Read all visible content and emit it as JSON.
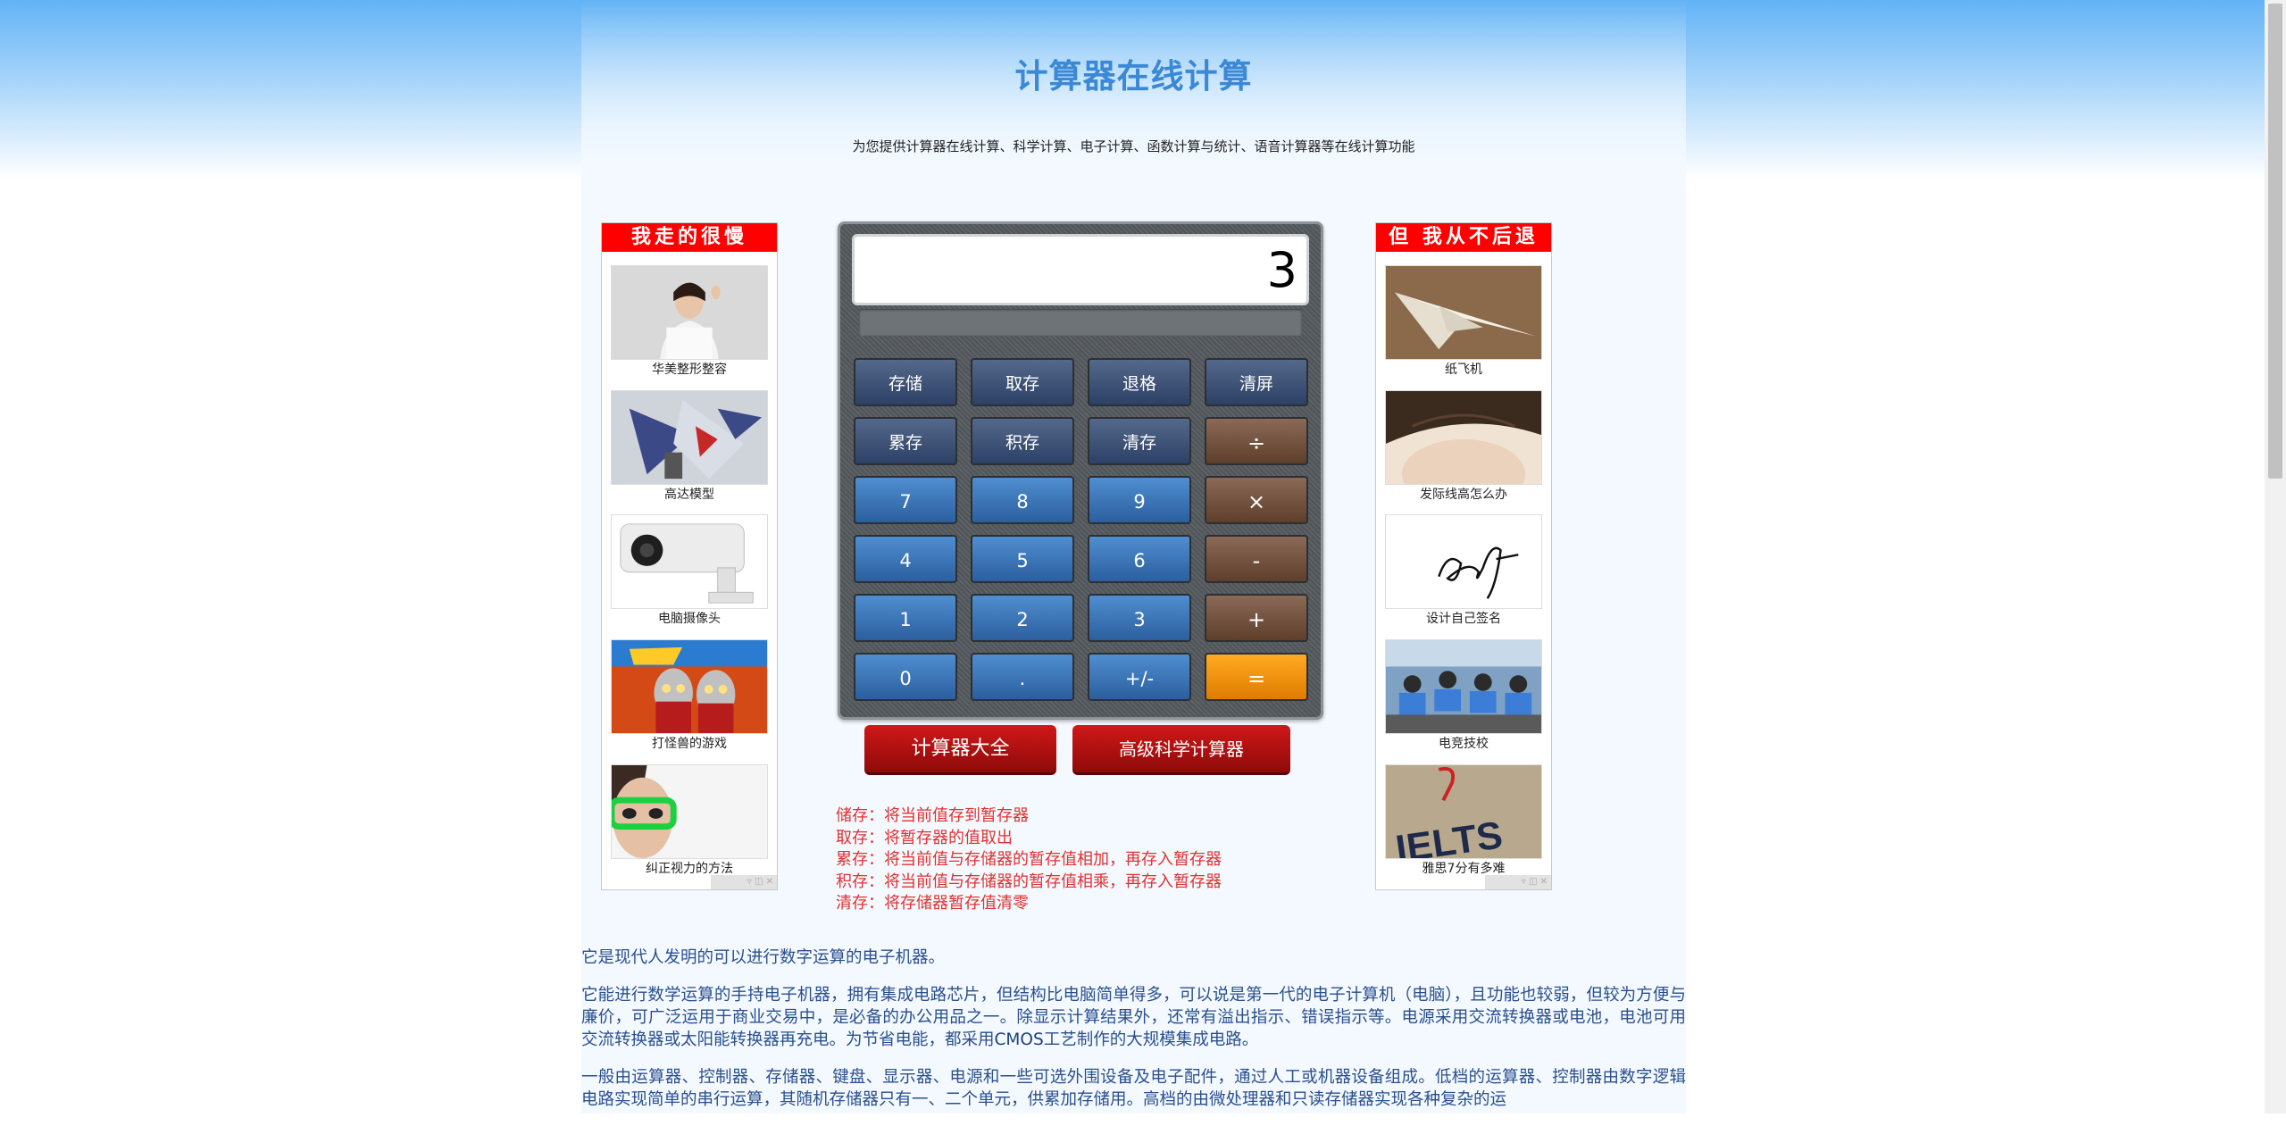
{
  "header": {
    "title": "计算器在线计算",
    "subtitle": "为您提供计算器在线计算、科学计算、电子计算、函数计算与统计、语音计算器等在线计算功能"
  },
  "left_ads": {
    "title": "我走的很慢",
    "items": [
      {
        "caption": "华美整形整容"
      },
      {
        "caption": "高达模型"
      },
      {
        "caption": "电脑摄像头"
      },
      {
        "caption": "打怪兽的游戏"
      },
      {
        "caption": "纠正视力的方法"
      }
    ]
  },
  "right_ads": {
    "title": "但 我从不后退",
    "items": [
      {
        "caption": "纸飞机"
      },
      {
        "caption": "发际线高怎么办"
      },
      {
        "caption": "设计自己签名"
      },
      {
        "caption": "电竞技校"
      },
      {
        "caption": "雅思7分有多难"
      }
    ]
  },
  "calculator": {
    "display": "3",
    "memory_keys": [
      "存储",
      "取存",
      "退格",
      "清屏",
      "累存",
      "积存",
      "清存"
    ],
    "keys": {
      "divide": "÷",
      "multiply": "×",
      "minus": "-",
      "plus": "+",
      "equals": "=",
      "n7": "7",
      "n8": "8",
      "n9": "9",
      "n4": "4",
      "n5": "5",
      "n6": "6",
      "n1": "1",
      "n2": "2",
      "n3": "3",
      "n0": "0",
      "dot": ".",
      "sign": "+/-"
    }
  },
  "links": {
    "all_calculators": "计算器大全",
    "scientific": "高级科学计算器"
  },
  "help": [
    "储存：将当前值存到暂存器",
    "取存：将暂存器的值取出",
    "累存：将当前值与存储器的暂存值相加，再存入暂存器",
    "积存：将当前值与存储器的暂存值相乘，再存入暂存器",
    "清存：将存储器暂存值清零"
  ],
  "article": {
    "p1": "它是现代人发明的可以进行数字运算的电子机器。",
    "p2a": "它能进行数学运算的手持电子机器，拥有集成电路芯片，但结构比电脑简单得多，可以说是第一代的电子计算机（电脑），且功能也较弱，但较为方便与廉价，可广泛运用于商业交易中，是必备的办公用品之一。除显示计算结果外，还常有溢出指示、错误指示等。电源采用交流转换器或电池，电池可用交流转换器或太阳能转换器再充电。为节省电能，都采用",
    "p2_cmos": "CMOS",
    "p2b": "工艺制作的大规模集成电路。",
    "p3": "一般由运算器、控制器、存储器、键盘、显示器、电源和一些可选外围设备及电子配件，通过人工或机器设备组成。低档的运算器、控制器由数字逻辑电路实现简单的串行运算，其随机存储器只有一、二个单元，供累加存储用。高档的由微处理器和只读存储器实现各种复杂的运"
  },
  "colors": {
    "title": "#3a88d6",
    "ad_header": "#ff0000",
    "help_text": "#e03131",
    "article_text": "#2a4f8e",
    "equals_key": "#ff9900",
    "operator_key": "#6e4b36",
    "number_key": "#3470b5",
    "link_button": "#b31212"
  }
}
